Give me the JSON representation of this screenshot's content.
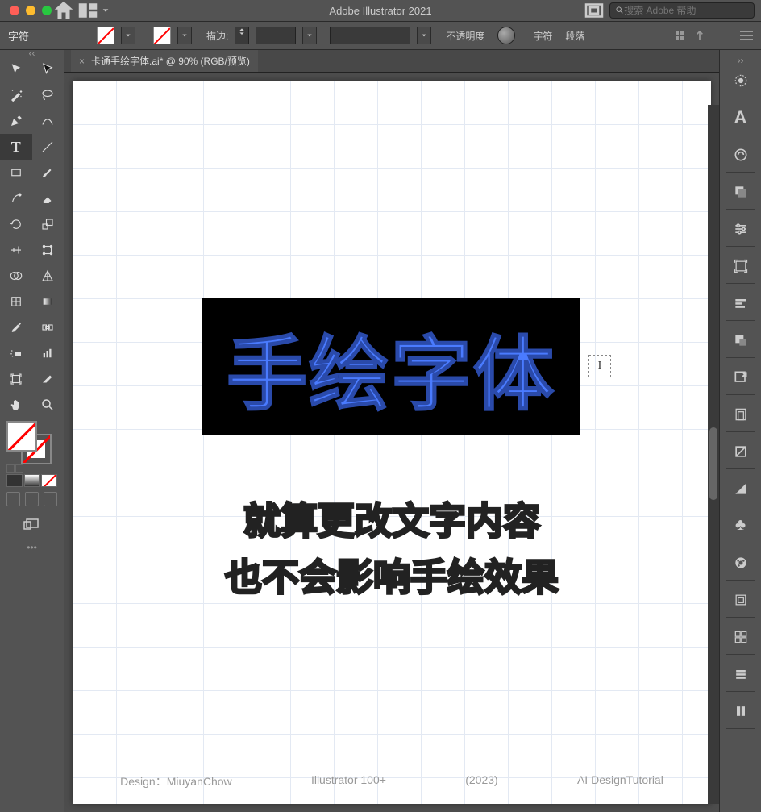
{
  "titlebar": {
    "app_title": "Adobe Illustrator 2021",
    "search_placeholder": "搜索 Adobe 帮助"
  },
  "controlbar": {
    "panel_label": "字符",
    "stroke_label": "描边:",
    "opacity_label": "不透明度",
    "character_label": "字符",
    "paragraph_label": "段落"
  },
  "document": {
    "tab_title": "卡通手绘字体.ai* @ 90% (RGB/预览)"
  },
  "canvas": {
    "main_text": "手绘字体",
    "caption_line1": "就算更改文字内容",
    "caption_line2": "也不会影响手绘效果",
    "footer_design": "Design：MiuyanChow",
    "footer_app": "Illustrator 100+",
    "footer_year": "(2023)",
    "footer_brand": "AI DesignTutorial"
  },
  "tools": {
    "selection": "selection",
    "direct_selection": "direct-selection",
    "magic_wand": "magic-wand",
    "lasso": "lasso",
    "pen": "pen",
    "curvature": "curvature",
    "type": "type",
    "line": "line",
    "rectangle": "rectangle",
    "brush": "brush",
    "shaper": "shaper",
    "eraser": "eraser",
    "rotate": "rotate",
    "scale": "scale",
    "width": "width",
    "free_transform": "free-transform",
    "shape_builder": "shape-builder",
    "perspective": "perspective",
    "mesh": "mesh",
    "gradient": "gradient",
    "eyedropper": "eyedropper",
    "blend": "blend",
    "symbol_sprayer": "symbol-sprayer",
    "graph": "graph",
    "artboard": "artboard",
    "slice": "slice",
    "hand": "hand",
    "zoom": "zoom"
  },
  "right_panels": [
    "properties",
    "character",
    "appearance",
    "layers",
    "sliders",
    "artboards-panel",
    "align",
    "pathfinder",
    "export",
    "libraries",
    "links",
    "color-guide",
    "swatches",
    "color",
    "stroke-panel",
    "symbols",
    "brushes",
    "graphic-styles"
  ]
}
